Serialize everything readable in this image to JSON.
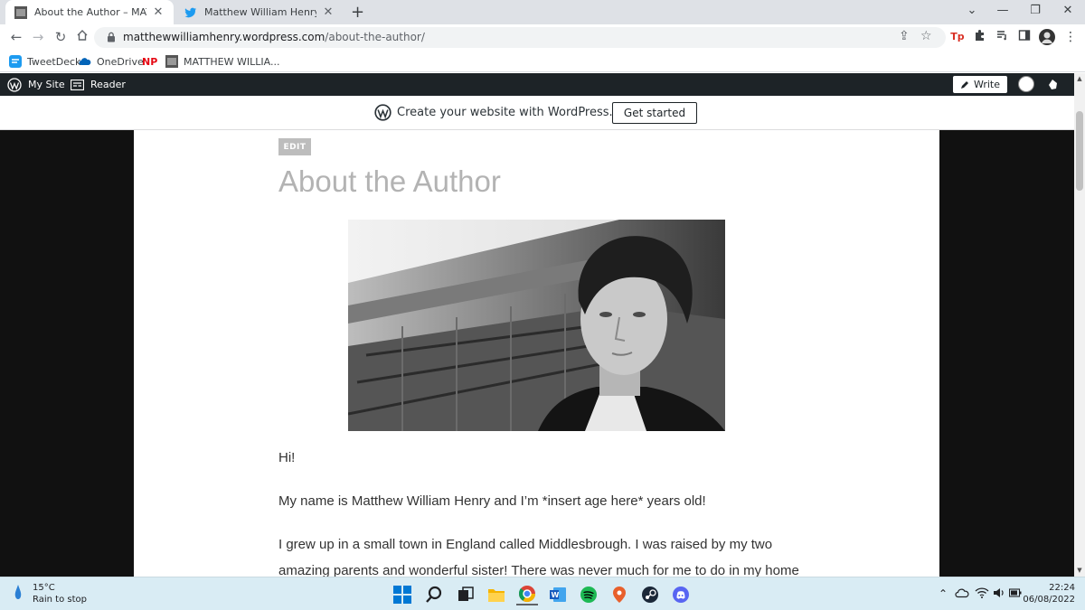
{
  "browser": {
    "tabs": [
      {
        "title": "About the Author – MATTHEW W",
        "active": true
      },
      {
        "title": "Matthew William Henry 📈🤢 (@",
        "active": false
      }
    ],
    "new_tab": "+",
    "window_controls": {
      "minimize": "—",
      "restore": "❐",
      "close": "✕",
      "tab_search": "⌄"
    },
    "url_domain": "matthewwilliamhenry.wordpress.com",
    "url_path": "/about-the-author/",
    "extension_tp": "Tp",
    "bookmarks": [
      "TweetDeck",
      "OneDrive",
      "NP",
      "MATTHEW WILLIA..."
    ]
  },
  "admin_bar": {
    "my_site": "My Site",
    "reader": "Reader",
    "write": "Write"
  },
  "banner": {
    "text": "Create your website with WordPress.com",
    "button": "Get started"
  },
  "page": {
    "edit": "EDIT",
    "title": "About the Author",
    "paragraphs": [
      "Hi!",
      "My name is Matthew William Henry and I’m *insert age here* years old!",
      "I grew up in a small town in England called Middlesbrough. I was raised by my two amazing parents and wonderful sister! There was never much for me to do in my home town, so I found a lot of the time I would"
    ]
  },
  "taskbar": {
    "temperature": "15°C",
    "weather": "Rain to stop",
    "time": "22:24",
    "date": "06/08/2022"
  },
  "colors": {
    "wp_bar": "#1d2327",
    "page_background": "#111111",
    "title_gray": "#b3b3b3",
    "taskbar": "#d9ecf4"
  }
}
